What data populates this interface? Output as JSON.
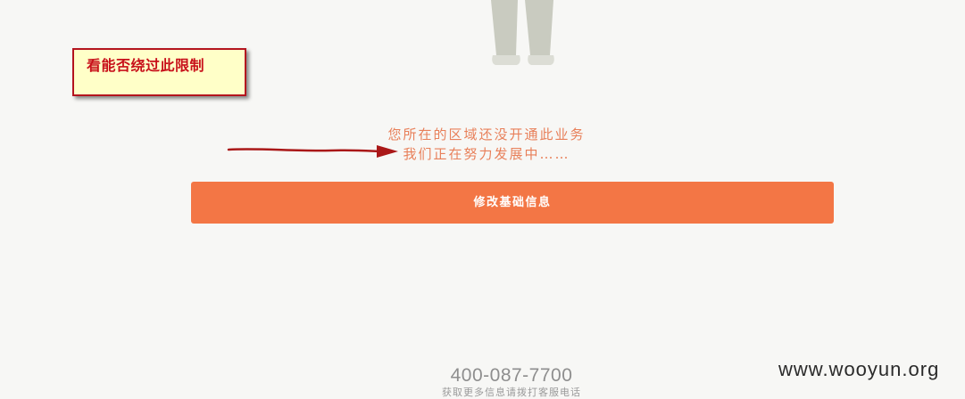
{
  "annotation": {
    "callout_text": "看能否绕过此限制"
  },
  "notice": {
    "line1": "您所在的区域还没开通此业务",
    "line2": "我们正在努力发展中……"
  },
  "actions": {
    "edit_basic_info_label": "修改基础信息"
  },
  "footer": {
    "phone": "400-087-7700",
    "caption": "获取更多信息请拨打客服电话"
  },
  "watermark": "www.wooyun.org",
  "colors": {
    "accent": "#f37645",
    "notice_text": "#e8805a",
    "callout_border": "#b4141e",
    "callout_background": "#ffffc8",
    "background": "#f7f7f5"
  },
  "icons": {
    "illustration": "person-legs-illustration",
    "annotation_arrow": "red-arrow-icon"
  }
}
